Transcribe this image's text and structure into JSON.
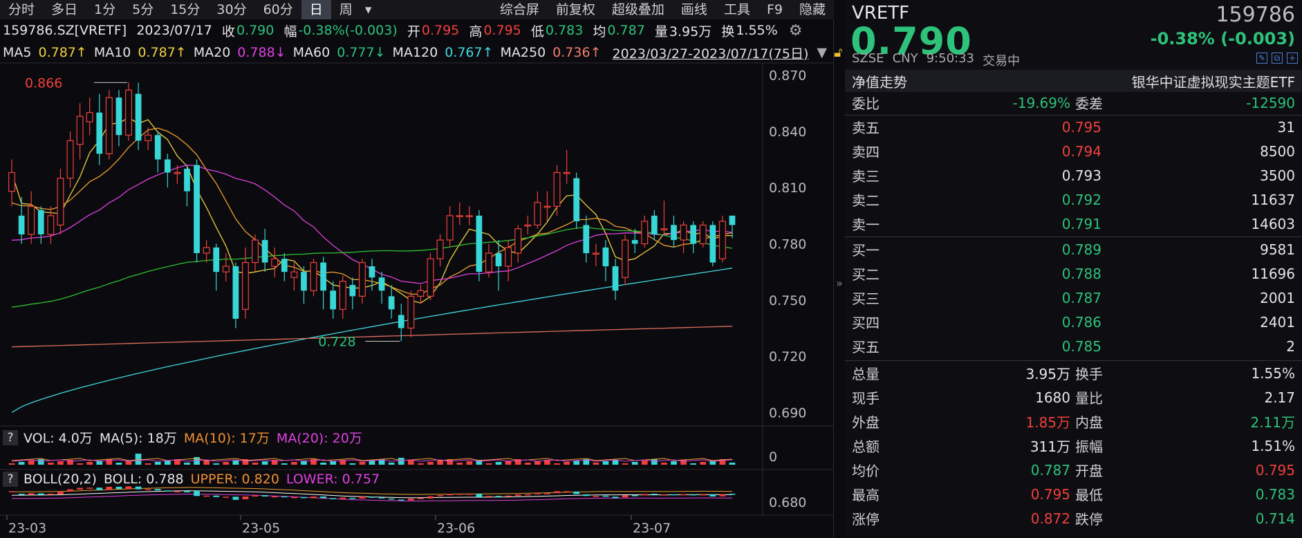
{
  "toolbar": {
    "tabs": [
      "分时",
      "多日",
      "1分",
      "5分",
      "15分",
      "30分",
      "60分",
      "日",
      "周"
    ],
    "active": "日",
    "dropdown": "▾",
    "actions": [
      "综合屏",
      "前复权",
      "超级叠加",
      "画线",
      "工具",
      "F9",
      "隐藏"
    ]
  },
  "info": {
    "code": "159786.SZ[VRETF]",
    "date": "2023/07/17",
    "close_label": "收",
    "close": "0.790",
    "chg_label": "幅",
    "chg": "-0.38%(-0.003)",
    "open_label": "开",
    "open": "0.795",
    "high_label": "高",
    "high": "0.795",
    "low_label": "低",
    "low": "0.783",
    "avg_label": "均",
    "avg": "0.787",
    "vol_label": "量",
    "vol": "3.95万",
    "turn_label": "换",
    "turn": "1.55%"
  },
  "ma": {
    "ma5": "MA5",
    "ma5_v": "0.787↑",
    "ma10": "MA10",
    "ma10_v": "0.787↑",
    "ma20": "MA20",
    "ma20_v": "0.788↓",
    "ma60": "MA60",
    "ma60_v": "0.777↓",
    "ma120": "MA120",
    "ma120_v": "0.767↑",
    "ma250": "MA250",
    "ma250_v": "0.736↑",
    "range": "2023/03/27-2023/07/17(75日)"
  },
  "vol_panel": {
    "q": "?",
    "vol": "VOL: 4.0万",
    "ma5": "MA(5): 18万",
    "ma10": "MA(10): 17万",
    "ma20": "MA(20): 20万",
    "axis": "0"
  },
  "boll_panel": {
    "q": "?",
    "name": "BOLL(20,2)",
    "boll": "BOLL: 0.788",
    "upper": "UPPER: 0.820",
    "lower": "LOWER: 0.757",
    "axis": "0.680"
  },
  "chart_data": {
    "type": "candlestick",
    "y_ticks": [
      "0.870",
      "0.840",
      "0.810",
      "0.780",
      "0.750",
      "0.720",
      "0.690"
    ],
    "ylim": [
      0.685,
      0.875
    ],
    "x_ticks": [
      "23-03",
      "23-05",
      "23-06",
      "23-07"
    ],
    "annotations": [
      {
        "text": "0.866",
        "value": 0.866,
        "kind": "max"
      },
      {
        "text": "0.728",
        "value": 0.728,
        "kind": "min"
      }
    ],
    "candles": [
      [
        0.808,
        0.818,
        0.825,
        0.8
      ],
      [
        0.795,
        0.785,
        0.805,
        0.78
      ],
      [
        0.785,
        0.8,
        0.808,
        0.78
      ],
      [
        0.798,
        0.785,
        0.8,
        0.78
      ],
      [
        0.785,
        0.795,
        0.8,
        0.78
      ],
      [
        0.79,
        0.815,
        0.82,
        0.785
      ],
      [
        0.815,
        0.835,
        0.84,
        0.81
      ],
      [
        0.833,
        0.848,
        0.855,
        0.825
      ],
      [
        0.845,
        0.85,
        0.858,
        0.838
      ],
      [
        0.85,
        0.828,
        0.86,
        0.822
      ],
      [
        0.828,
        0.858,
        0.862,
        0.825
      ],
      [
        0.858,
        0.838,
        0.862,
        0.832
      ],
      [
        0.838,
        0.862,
        0.866,
        0.835
      ],
      [
        0.86,
        0.835,
        0.866,
        0.83
      ],
      [
        0.835,
        0.838,
        0.842,
        0.83
      ],
      [
        0.838,
        0.825,
        0.84,
        0.818
      ],
      [
        0.825,
        0.818,
        0.828,
        0.81
      ],
      [
        0.818,
        0.818,
        0.822,
        0.812
      ],
      [
        0.82,
        0.808,
        0.822,
        0.8
      ],
      [
        0.822,
        0.775,
        0.825,
        0.77
      ],
      [
        0.775,
        0.778,
        0.782,
        0.77
      ],
      [
        0.778,
        0.765,
        0.78,
        0.755
      ],
      [
        0.765,
        0.768,
        0.775,
        0.76
      ],
      [
        0.768,
        0.74,
        0.77,
        0.735
      ],
      [
        0.745,
        0.77,
        0.778,
        0.74
      ],
      [
        0.77,
        0.782,
        0.785,
        0.765
      ],
      [
        0.782,
        0.77,
        0.788,
        0.765
      ],
      [
        0.768,
        0.772,
        0.778,
        0.762
      ],
      [
        0.772,
        0.765,
        0.775,
        0.76
      ],
      [
        0.762,
        0.765,
        0.77,
        0.755
      ],
      [
        0.765,
        0.755,
        0.768,
        0.748
      ],
      [
        0.755,
        0.77,
        0.772,
        0.752
      ],
      [
        0.77,
        0.755,
        0.773,
        0.745
      ],
      [
        0.755,
        0.745,
        0.76,
        0.74
      ],
      [
        0.745,
        0.76,
        0.763,
        0.74
      ],
      [
        0.758,
        0.752,
        0.762,
        0.745
      ],
      [
        0.752,
        0.77,
        0.772,
        0.748
      ],
      [
        0.768,
        0.762,
        0.772,
        0.755
      ],
      [
        0.762,
        0.755,
        0.765,
        0.748
      ],
      [
        0.752,
        0.745,
        0.758,
        0.74
      ],
      [
        0.742,
        0.735,
        0.748,
        0.728
      ],
      [
        0.735,
        0.752,
        0.755,
        0.73
      ],
      [
        0.752,
        0.755,
        0.758,
        0.748
      ],
      [
        0.752,
        0.772,
        0.775,
        0.75
      ],
      [
        0.772,
        0.782,
        0.785,
        0.768
      ],
      [
        0.782,
        0.795,
        0.8,
        0.778
      ],
      [
        0.795,
        0.795,
        0.802,
        0.79
      ],
      [
        0.795,
        0.795,
        0.8,
        0.79
      ],
      [
        0.795,
        0.765,
        0.798,
        0.76
      ],
      [
        0.765,
        0.775,
        0.78,
        0.762
      ],
      [
        0.775,
        0.768,
        0.782,
        0.755
      ],
      [
        0.768,
        0.778,
        0.782,
        0.76
      ],
      [
        0.775,
        0.788,
        0.79,
        0.77
      ],
      [
        0.79,
        0.79,
        0.795,
        0.785
      ],
      [
        0.79,
        0.802,
        0.808,
        0.788
      ],
      [
        0.8,
        0.8,
        0.808,
        0.792
      ],
      [
        0.8,
        0.818,
        0.822,
        0.795
      ],
      [
        0.818,
        0.818,
        0.83,
        0.812
      ],
      [
        0.815,
        0.792,
        0.818,
        0.788
      ],
      [
        0.79,
        0.775,
        0.795,
        0.77
      ],
      [
        0.775,
        0.775,
        0.78,
        0.768
      ],
      [
        0.778,
        0.768,
        0.782,
        0.76
      ],
      [
        0.768,
        0.755,
        0.772,
        0.75
      ],
      [
        0.762,
        0.782,
        0.785,
        0.758
      ],
      [
        0.782,
        0.78,
        0.788,
        0.775
      ],
      [
        0.78,
        0.792,
        0.795,
        0.778
      ],
      [
        0.795,
        0.785,
        0.798,
        0.782
      ],
      [
        0.788,
        0.788,
        0.803,
        0.785
      ],
      [
        0.79,
        0.782,
        0.795,
        0.778
      ],
      [
        0.782,
        0.79,
        0.792,
        0.775
      ],
      [
        0.79,
        0.78,
        0.792,
        0.775
      ],
      [
        0.78,
        0.79,
        0.792,
        0.778
      ],
      [
        0.79,
        0.77,
        0.792,
        0.768
      ],
      [
        0.772,
        0.792,
        0.795,
        0.77
      ],
      [
        0.795,
        0.79,
        0.795,
        0.783
      ]
    ]
  },
  "right": {
    "name": "VRETF",
    "code": "159786",
    "price": "0.790",
    "change": "-0.38% (-0.003)",
    "exchange": "SZSE",
    "currency": "CNY",
    "time": "9:50:33",
    "status": "交易中",
    "icons": [
      "pen-icon",
      "copy-icon",
      "add-icon"
    ],
    "icon_glyphs": [
      "✎",
      "⧉",
      "+"
    ],
    "band_left": "净值走势",
    "band_right": "银华中证虚拟现实主题ETF",
    "ratio": {
      "l1": "委比",
      "v1": "-19.69%",
      "l2": "委差",
      "v2": "-12590"
    },
    "asks": [
      {
        "label": "卖五",
        "price": "0.795",
        "vol": "31",
        "color": "red"
      },
      {
        "label": "卖四",
        "price": "0.794",
        "vol": "8500",
        "color": "red"
      },
      {
        "label": "卖三",
        "price": "0.793",
        "vol": "3500",
        "color": "white"
      },
      {
        "label": "卖二",
        "price": "0.792",
        "vol": "11637",
        "color": "green"
      },
      {
        "label": "卖一",
        "price": "0.791",
        "vol": "14603",
        "color": "green"
      }
    ],
    "bids": [
      {
        "label": "买一",
        "price": "0.789",
        "vol": "9581",
        "color": "green"
      },
      {
        "label": "买二",
        "price": "0.788",
        "vol": "11696",
        "color": "green"
      },
      {
        "label": "买三",
        "price": "0.787",
        "vol": "2001",
        "color": "green"
      },
      {
        "label": "买四",
        "price": "0.786",
        "vol": "2401",
        "color": "green"
      },
      {
        "label": "买五",
        "price": "0.785",
        "vol": "2",
        "color": "green"
      }
    ],
    "stats": [
      {
        "l1": "总量",
        "v1": "3.95万",
        "c1": "white",
        "l2": "换手",
        "v2": "1.55%",
        "c2": "white"
      },
      {
        "l1": "现手",
        "v1": "1680",
        "c1": "white",
        "l2": "量比",
        "v2": "2.17",
        "c2": "white"
      },
      {
        "l1": "外盘",
        "v1": "1.85万",
        "c1": "red",
        "l2": "内盘",
        "v2": "2.11万",
        "c2": "green"
      },
      {
        "l1": "总额",
        "v1": "311万",
        "c1": "white",
        "l2": "振幅",
        "v2": "1.51%",
        "c2": "white"
      },
      {
        "l1": "均价",
        "v1": "0.787",
        "c1": "green",
        "l2": "开盘",
        "v2": "0.795",
        "c2": "red"
      },
      {
        "l1": "最高",
        "v1": "0.795",
        "c1": "red",
        "l2": "最低",
        "v2": "0.783",
        "c2": "green"
      },
      {
        "l1": "涨停",
        "v1": "0.872",
        "c1": "red",
        "l2": "跌停",
        "v2": "0.714",
        "c2": "green"
      }
    ]
  }
}
